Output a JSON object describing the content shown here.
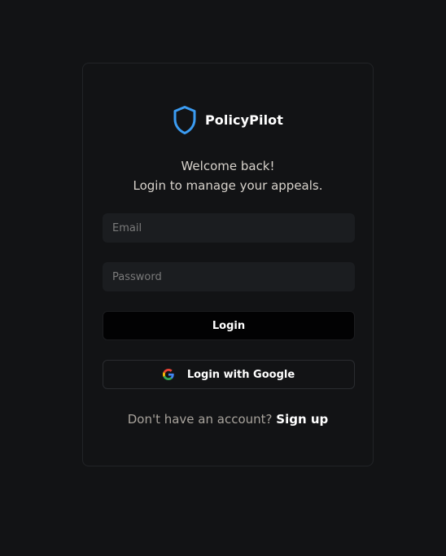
{
  "brand": {
    "name": "PolicyPilot",
    "logo_icon": "shield-icon",
    "accent_color": "#3b9cf2"
  },
  "welcome": {
    "line1": "Welcome back!",
    "line2": "Login to manage your appeals."
  },
  "form": {
    "email_placeholder": "Email",
    "email_value": "",
    "password_placeholder": "Password",
    "password_value": "",
    "login_label": "Login",
    "google_label": "Login with Google",
    "google_icon": "google-icon"
  },
  "signup": {
    "prompt": "Don't have an account?",
    "link_label": "Sign up"
  },
  "colors": {
    "background": "#121315",
    "input_background": "#1b1d20",
    "text": "#ffffff"
  }
}
